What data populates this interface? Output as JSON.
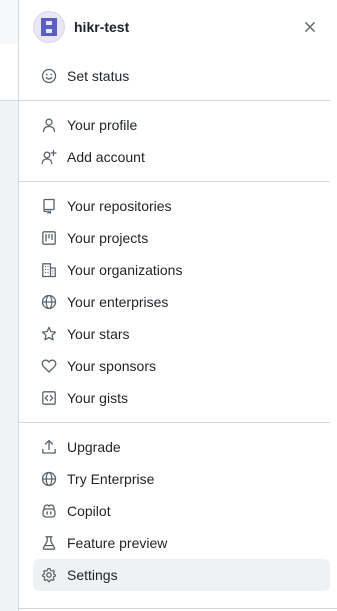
{
  "header": {
    "username": "hikr-test",
    "avatar_icon": "identicon-avatar",
    "avatar_color": "#5c5cc4",
    "close_icon": "close-icon"
  },
  "menu": {
    "status": {
      "label": "Set status",
      "icon": "smiley-icon"
    },
    "profile": {
      "label": "Your profile",
      "icon": "person-icon"
    },
    "add_account": {
      "label": "Add account",
      "icon": "person-add-icon"
    },
    "repositories": {
      "label": "Your repositories",
      "icon": "repo-icon"
    },
    "projects": {
      "label": "Your projects",
      "icon": "project-icon"
    },
    "organizations": {
      "label": "Your organizations",
      "icon": "organization-icon"
    },
    "enterprises": {
      "label": "Your enterprises",
      "icon": "globe-icon"
    },
    "stars": {
      "label": "Your stars",
      "icon": "star-icon"
    },
    "sponsors": {
      "label": "Your sponsors",
      "icon": "heart-icon"
    },
    "gists": {
      "label": "Your gists",
      "icon": "code-square-icon"
    },
    "upgrade": {
      "label": "Upgrade",
      "icon": "upload-icon"
    },
    "try_enterprise": {
      "label": "Try Enterprise",
      "icon": "globe-icon"
    },
    "copilot": {
      "label": "Copilot",
      "icon": "copilot-icon"
    },
    "feature_preview": {
      "label": "Feature preview",
      "icon": "beaker-icon"
    },
    "settings": {
      "label": "Settings",
      "icon": "gear-icon"
    }
  },
  "colors": {
    "text": "#1f2328",
    "icon": "#59636e",
    "divider": "#d1d9e0",
    "active_bg": "#eff1f3"
  }
}
